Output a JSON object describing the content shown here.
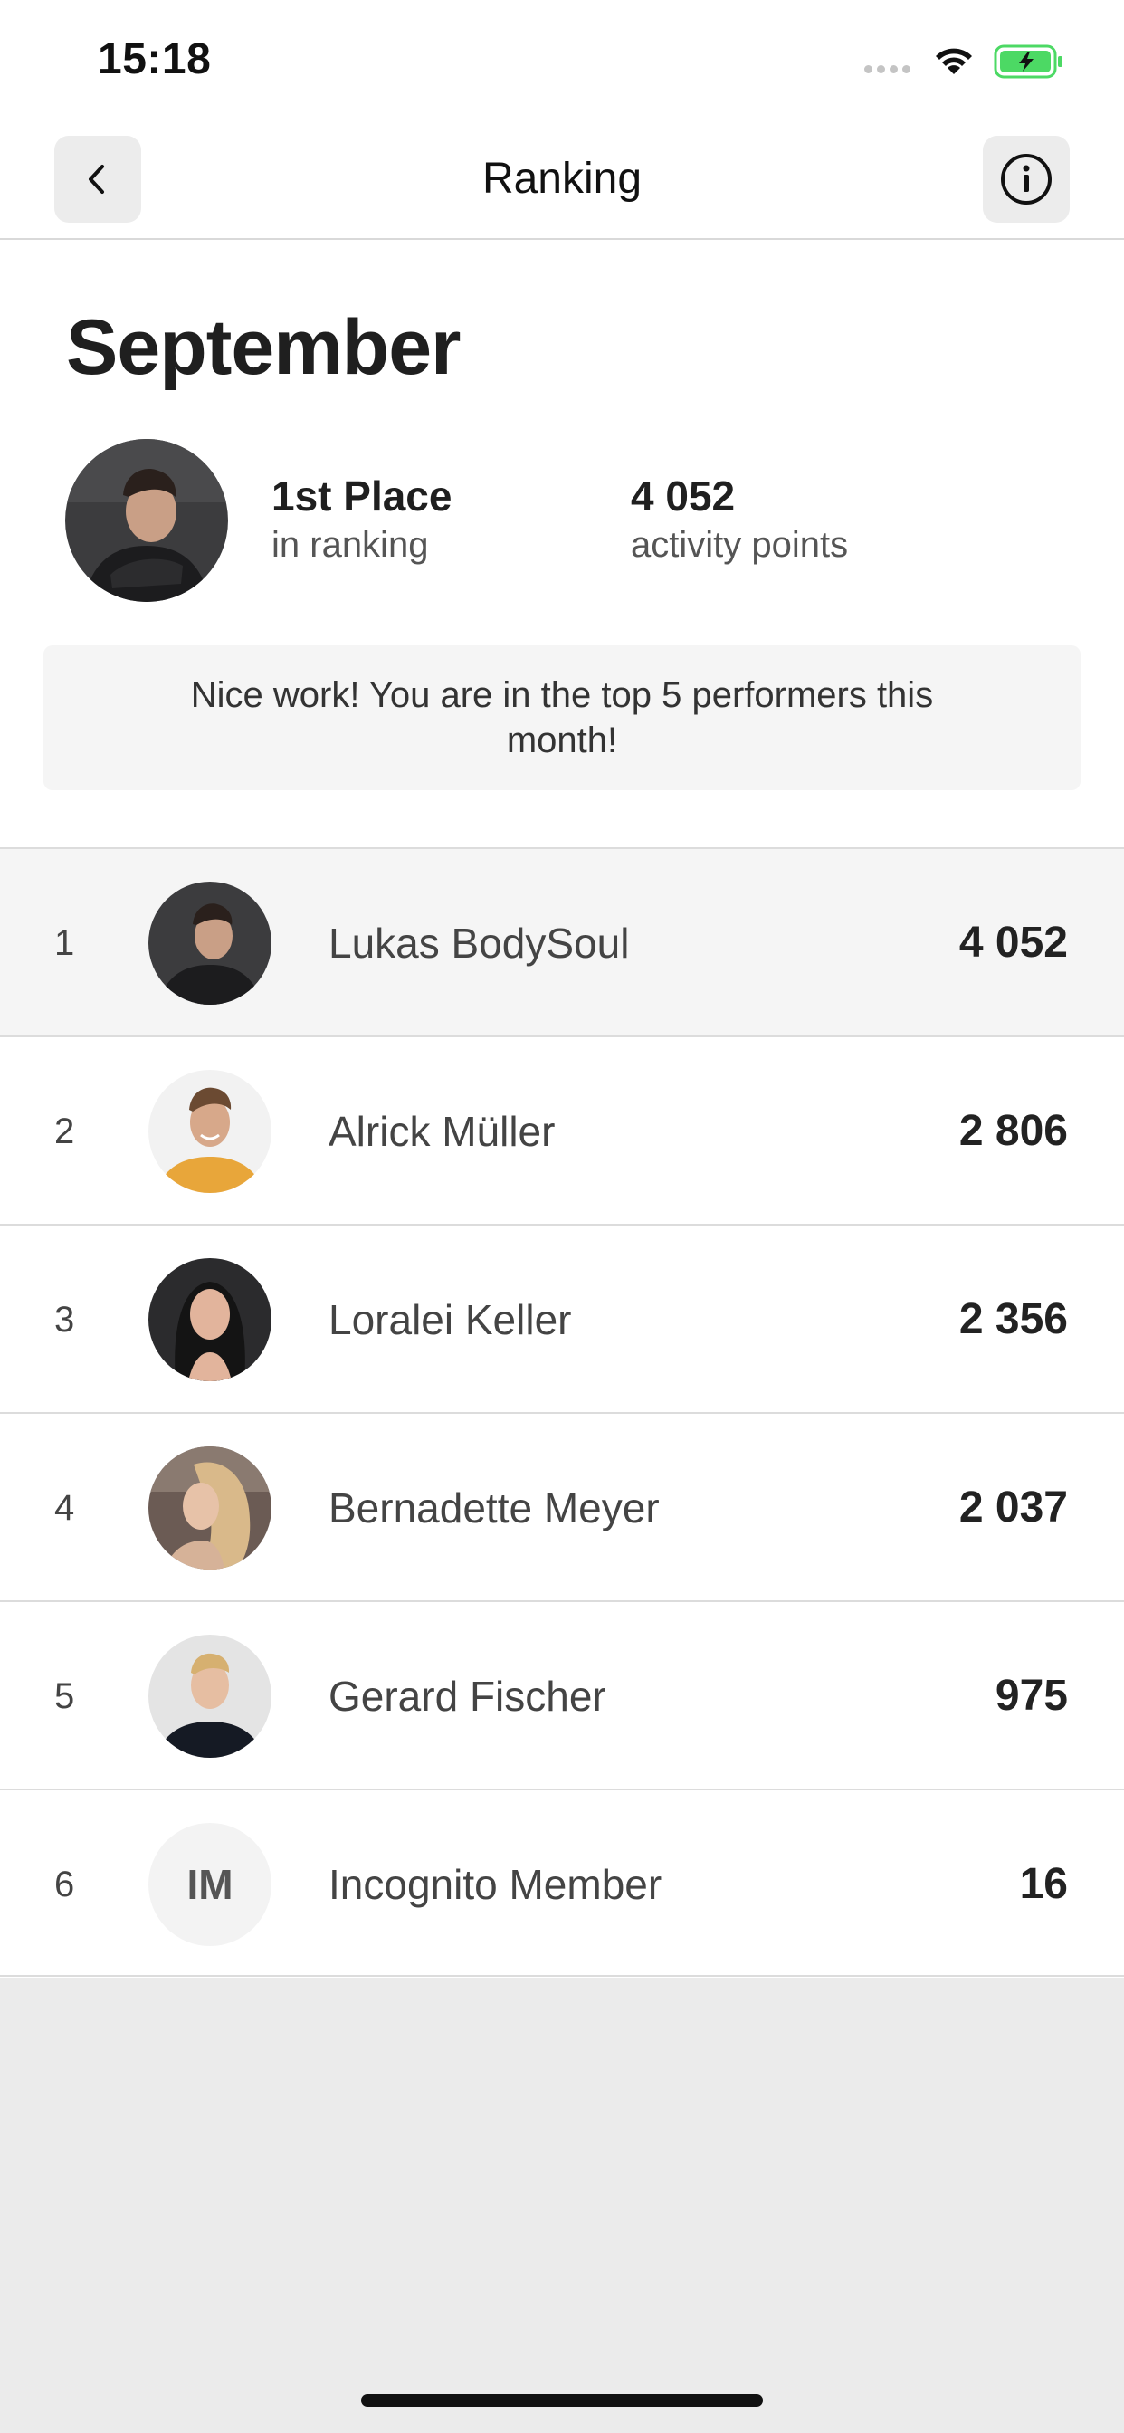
{
  "status_bar": {
    "time": "15:18"
  },
  "nav": {
    "title": "Ranking"
  },
  "header": {
    "month": "September",
    "rank_main": "1st Place",
    "rank_sub": "in ranking",
    "points_main": "4 052",
    "points_sub": "activity points",
    "notice": "Nice work! You are in the top 5 performers this month!"
  },
  "ranking": [
    {
      "rank": "1",
      "name": "Lukas BodySoul",
      "points": "4 052",
      "avatar": "photo-man-dark-hair",
      "highlight": true
    },
    {
      "rank": "2",
      "name": "Alrick Müller",
      "points": "2 806",
      "avatar": "photo-man-yellow-shirt"
    },
    {
      "rank": "3",
      "name": "Loralei Keller",
      "points": "2 356",
      "avatar": "photo-woman-dark-hair"
    },
    {
      "rank": "4",
      "name": "Bernadette Meyer",
      "points": "2 037",
      "avatar": "photo-woman-blonde"
    },
    {
      "rank": "5",
      "name": "Gerard Fischer",
      "points": "975",
      "avatar": "photo-man-black-tshirt"
    },
    {
      "rank": "6",
      "name": "Incognito Member",
      "points": "16",
      "initials": "IM"
    }
  ],
  "colors": {
    "battery": "#4cd964",
    "highlight_row": "#f5f5f5",
    "footer_bg": "#ebebeb"
  }
}
